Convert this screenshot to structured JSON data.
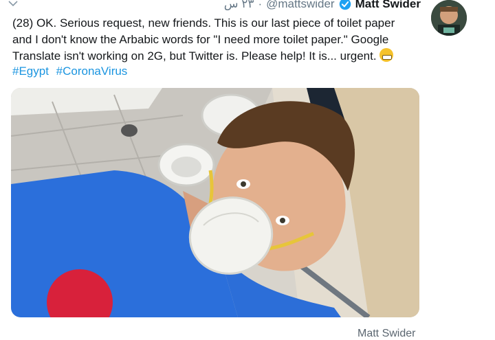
{
  "tweet": {
    "display_name": "Matt Swider",
    "handle": "@mattswider",
    "time": "٢٣ س",
    "separator": "·",
    "text_lines": [
      "(28) OK. Serious request, new friends. This is our last piece of toilet paper",
      "and I don't know the Arbabic words for \"I need more toilet paper.\" Google",
      "Translate isn't working on 2G, but Twitter is. Please help! It is... urgent."
    ],
    "hashtags": [
      "#Egypt",
      "#CoronaVirus"
    ]
  },
  "media": {
    "credit": "Matt Swider"
  },
  "icons": {
    "verified": "verified-badge-icon",
    "menu": "chevron-down-icon",
    "emoji": "grimacing-face-emoji"
  },
  "colors": {
    "link": "#1b95e0",
    "verified": "#1da1f2",
    "muted": "#657786"
  }
}
